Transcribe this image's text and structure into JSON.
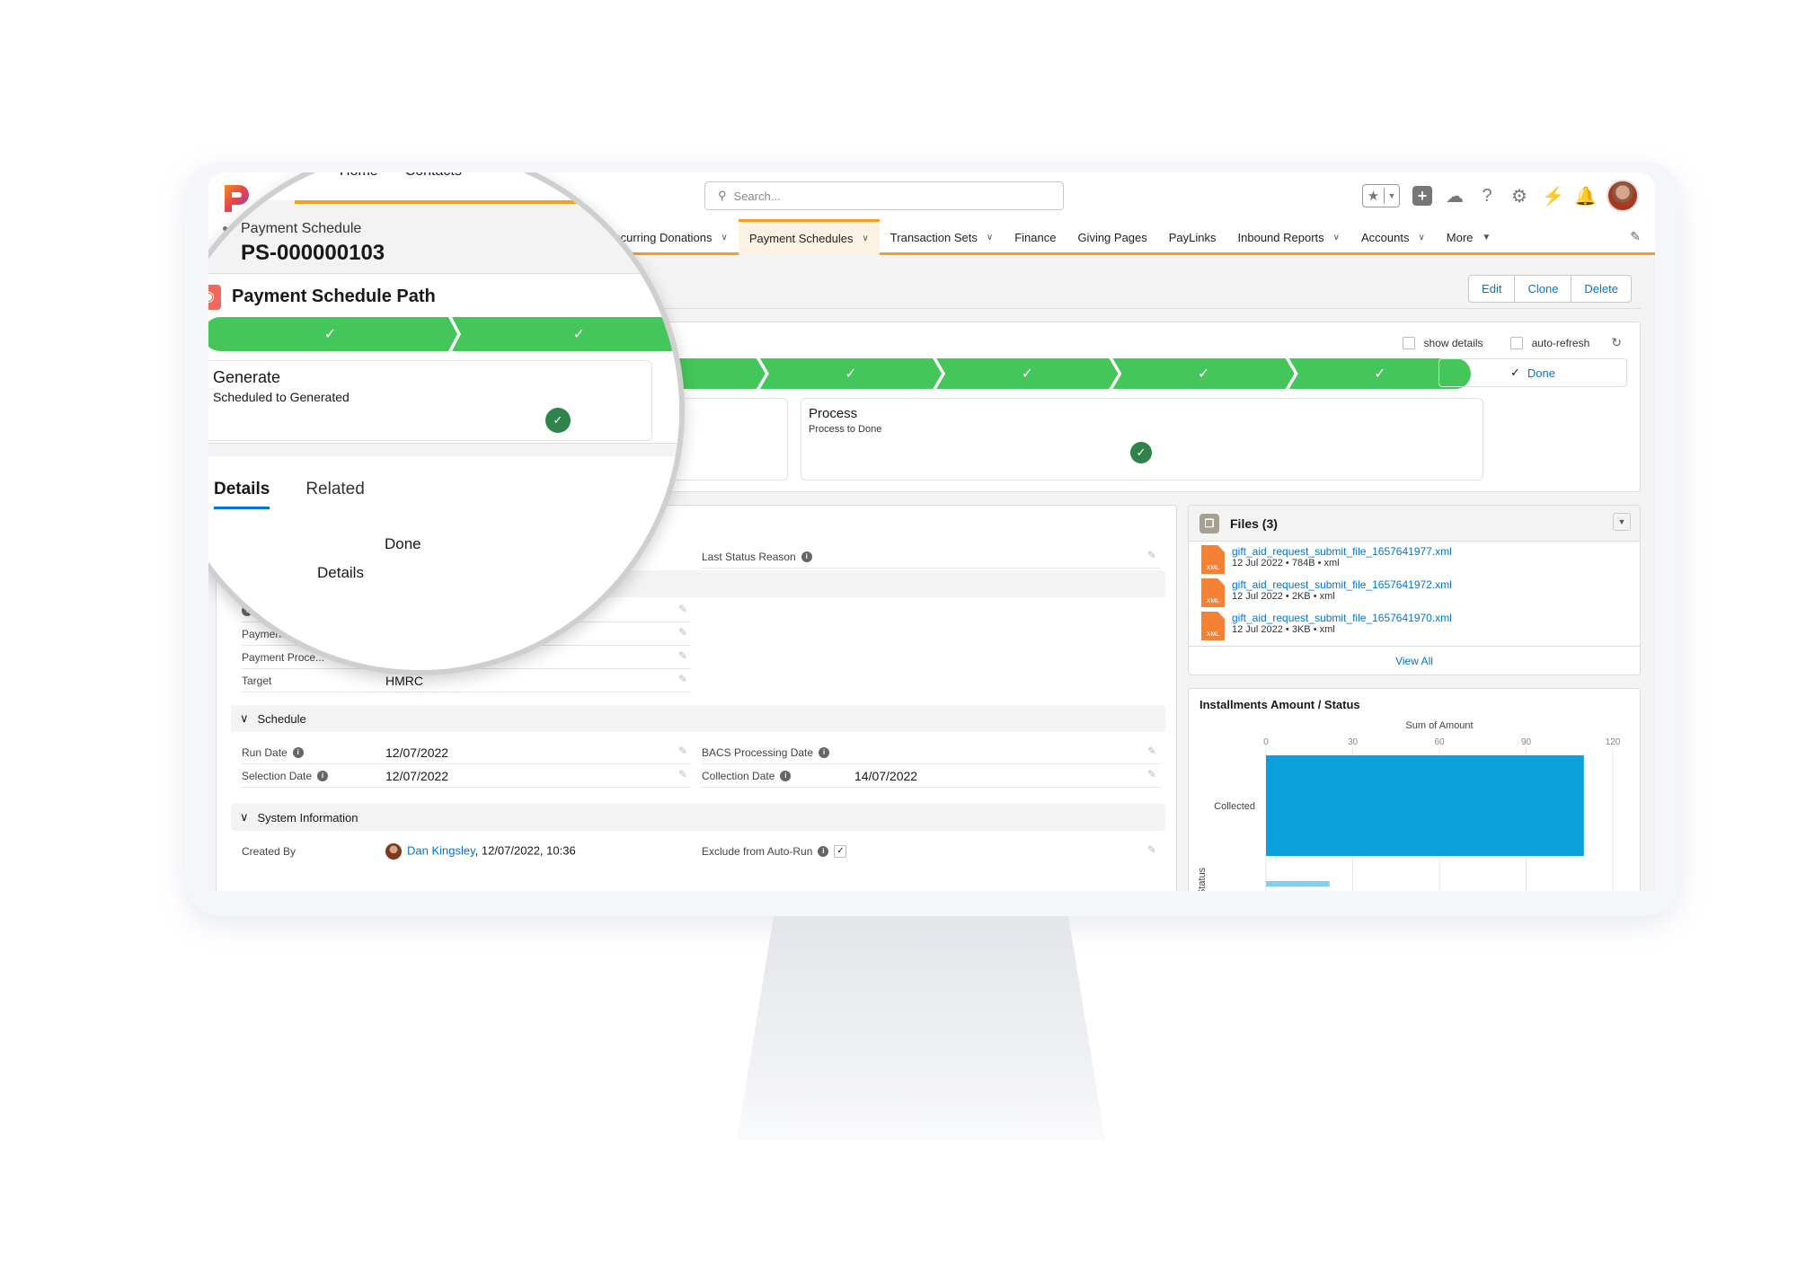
{
  "header": {
    "search_placeholder": "Search...",
    "home_items": [
      "Home",
      "Contacts"
    ],
    "icons": [
      "favorites-star-icon",
      "add-icon",
      "trailhead-icon",
      "help-icon",
      "setup-gear-icon",
      "lightning-icon",
      "notifications-bell-icon",
      "user-avatar"
    ]
  },
  "nav": {
    "items": [
      {
        "label": "Recurring Donations",
        "dropdown": true,
        "active": false
      },
      {
        "label": "Payment Schedules",
        "dropdown": true,
        "active": true
      },
      {
        "label": "Transaction Sets",
        "dropdown": true,
        "active": false
      },
      {
        "label": "Finance",
        "dropdown": false,
        "active": false
      },
      {
        "label": "Giving Pages",
        "dropdown": false,
        "active": false
      },
      {
        "label": "PayLinks",
        "dropdown": false,
        "active": false
      },
      {
        "label": "Inbound Reports",
        "dropdown": true,
        "active": false
      },
      {
        "label": "Accounts",
        "dropdown": true,
        "active": false
      },
      {
        "label": "More",
        "dropdown": true,
        "active": false
      }
    ]
  },
  "record": {
    "type": "Payment Schedule",
    "name": "PS-000000103",
    "buttons": {
      "edit": "Edit",
      "clone": "Clone",
      "delete": "Delete"
    }
  },
  "path": {
    "title": "Payment Schedule Path",
    "show_details": "show details",
    "auto_refresh": "auto-refresh",
    "segments_complete": 7,
    "done_label": "Done",
    "stages": [
      {
        "name": "Generate",
        "description": "Scheduled to Generated"
      },
      {
        "name": "Process",
        "description": "Process to Done"
      }
    ]
  },
  "details": {
    "tabs": [
      "Details",
      "Related"
    ],
    "active_tab": "Details",
    "status_value": "Done",
    "section_partial": "Details",
    "fields_top": [
      {
        "label": "Payment ...",
        "value": ""
      },
      {
        "label": "Payment Proce...",
        "value": ""
      },
      {
        "label": "Target",
        "value": "HMRC"
      }
    ],
    "last_status_reason_label": "Last Status Reason",
    "schedule": {
      "title": "Schedule",
      "run_date_label": "Run Date",
      "run_date": "12/07/2022",
      "selection_date_label": "Selection Date",
      "selection_date": "12/07/2022",
      "bacs_label": "BACS Processing Date",
      "bacs_value": "",
      "collection_date_label": "Collection Date",
      "collection_date": "14/07/2022"
    },
    "system": {
      "title": "System Information",
      "created_by_label": "Created By",
      "created_by_name": "Dan Kingsley",
      "created_by_date": ", 12/07/2022, 10:36",
      "exclude_label": "Exclude from Auto-Run",
      "exclude_checked": true
    }
  },
  "files": {
    "title": "Files (3)",
    "items": [
      {
        "name": "gift_aid_request_submit_file_1657641977.xml",
        "meta": "12 Jul 2022 • 784B • xml",
        "type": "XML"
      },
      {
        "name": "gift_aid_request_submit_file_1657641972.xml",
        "meta": "12 Jul 2022 • 2KB • xml",
        "type": "XML"
      },
      {
        "name": "gift_aid_request_submit_file_1657641970.xml",
        "meta": "12 Jul 2022 • 3KB • xml",
        "type": "XML"
      }
    ],
    "view_all": "View All"
  },
  "chart_data": {
    "type": "bar",
    "orientation": "horizontal",
    "title": "Installments Amount / Status",
    "xlabel": "Sum of Amount",
    "ylabel": "Status",
    "categories": [
      "Collected",
      ""
    ],
    "values": [
      110,
      22
    ],
    "xlim": [
      0,
      120
    ],
    "xticks": [
      0,
      30,
      60,
      90,
      120
    ],
    "grid": true,
    "color": "#0b9fdb"
  }
}
